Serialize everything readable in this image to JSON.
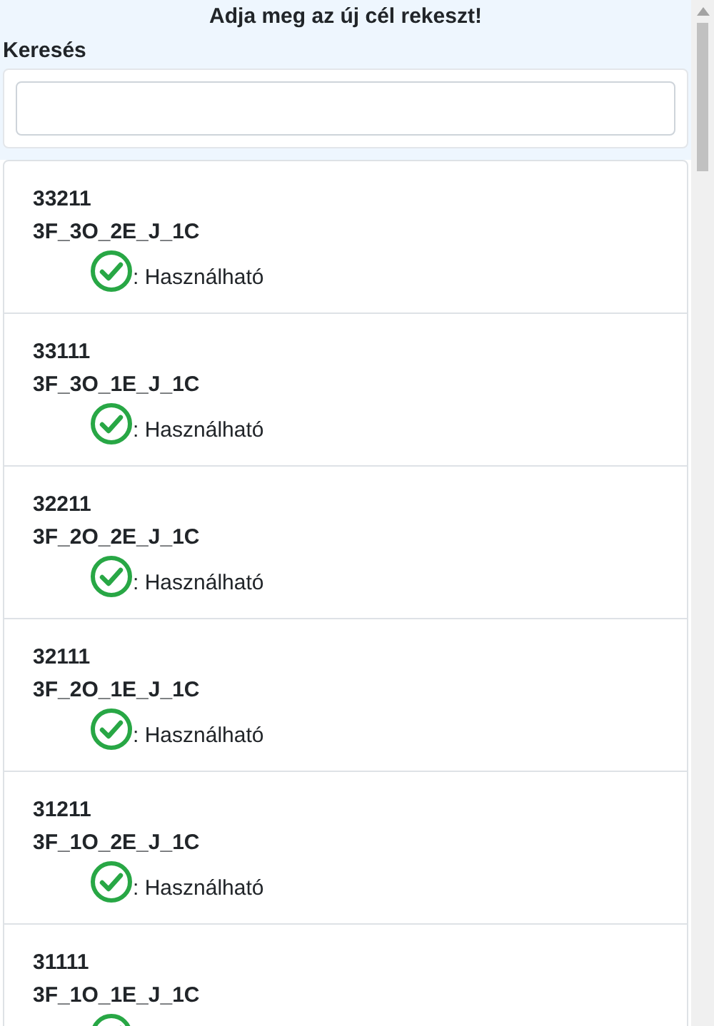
{
  "title": "Adja meg az új cél rekeszt!",
  "search": {
    "label": "Keresés"
  },
  "items": [
    {
      "number": "33211",
      "code": "3F_3O_2E_J_1C",
      "available": true,
      "status_text": ": Használható"
    },
    {
      "number": "33111",
      "code": "3F_3O_1E_J_1C",
      "available": true,
      "status_text": ": Használható"
    },
    {
      "number": "32211",
      "code": "3F_2O_2E_J_1C",
      "available": true,
      "status_text": ": Használható"
    },
    {
      "number": "32111",
      "code": "3F_2O_1E_J_1C",
      "available": true,
      "status_text": ": Használható"
    },
    {
      "number": "31211",
      "code": "3F_1O_2E_J_1C",
      "available": true,
      "status_text": ": Használható"
    },
    {
      "number": "31111",
      "code": "3F_1O_1E_J_1C",
      "available": true
    }
  ]
}
